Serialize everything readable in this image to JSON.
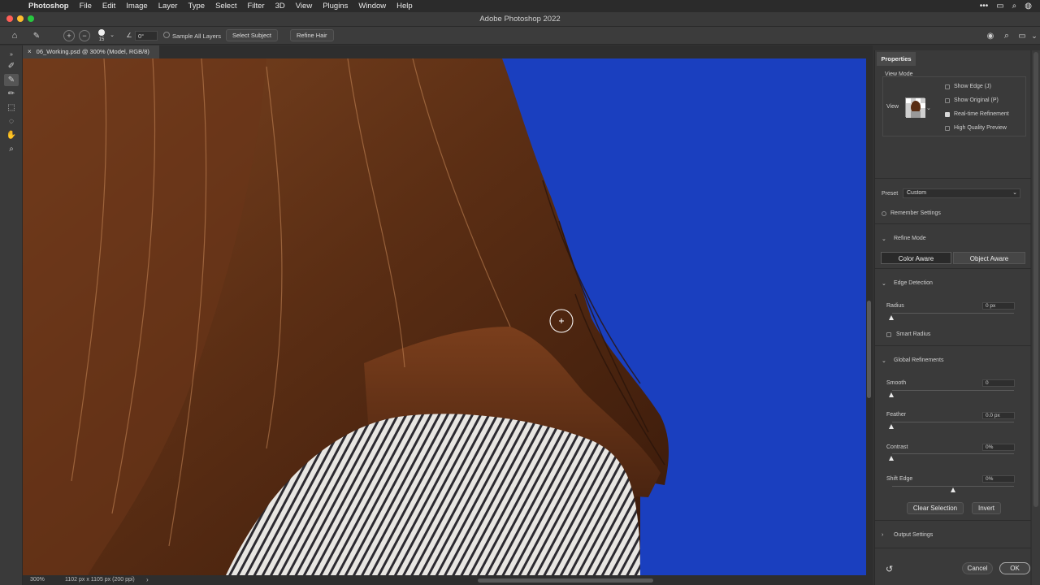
{
  "menubar": {
    "app": "Photoshop",
    "items": [
      "File",
      "Edit",
      "Image",
      "Layer",
      "Type",
      "Select",
      "Filter",
      "3D",
      "View",
      "Plugins",
      "Window",
      "Help"
    ]
  },
  "window": {
    "title": "Adobe Photoshop 2022"
  },
  "options": {
    "brush_size": "15",
    "angle": "0°",
    "sample_all_layers": "Sample All Layers",
    "select_subject": "Select Subject",
    "refine_hair": "Refine Hair"
  },
  "document": {
    "tab_label": "06_Working.psd @ 300% (Model, RGB/8)",
    "zoom": "300%",
    "doc_info": "1102 px x 1105 px (200 ppi)"
  },
  "properties": {
    "tab": "Properties",
    "view_mode": {
      "heading": "View Mode",
      "view_label": "View",
      "show_edge": "Show Edge (J)",
      "show_original": "Show Original (P)",
      "realtime": "Real-time Refinement",
      "hq_preview": "High Quality Preview",
      "realtime_checked": true
    },
    "preset_label": "Preset",
    "preset_value": "Custom",
    "remember": "Remember Settings",
    "refine_mode": {
      "heading": "Refine Mode",
      "color_aware": "Color Aware",
      "object_aware": "Object Aware"
    },
    "edge_detection": {
      "heading": "Edge Detection",
      "radius_label": "Radius",
      "radius_value": "0 px",
      "smart_radius": "Smart Radius"
    },
    "global": {
      "heading": "Global Refinements",
      "smooth_label": "Smooth",
      "smooth_value": "0",
      "feather_label": "Feather",
      "feather_value": "0.0 px",
      "contrast_label": "Contrast",
      "contrast_value": "0%",
      "shift_label": "Shift Edge",
      "shift_value": "0%"
    },
    "clear_selection": "Clear Selection",
    "invert": "Invert",
    "output": {
      "heading": "Output Settings"
    },
    "cancel": "Cancel",
    "ok": "OK"
  }
}
